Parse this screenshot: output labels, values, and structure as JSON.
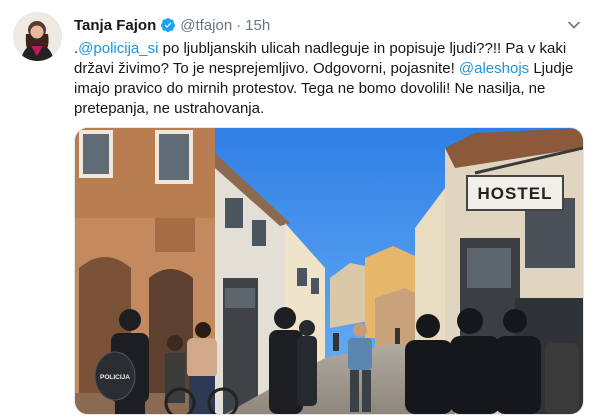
{
  "tweet": {
    "author_name": "Tanja Fajon",
    "handle": "@tfajon",
    "separator": "·",
    "time": "15h",
    "text_parts": {
      "p1": ".",
      "m1": "@policija_si",
      "p2": " po ljubljanskih ulicah nadleguje in popisuje ljudi??!! Pa v kaki državi živimo? To je nesprejemljivo. Odgovorni, pojasnite! ",
      "m2": "@aleshojs",
      "p3": " Ljudje imajo pravico do mirnih protestov. Tega ne bomo dovolili! Ne nasilja, ne pretepanja, ne ustrahovanja."
    }
  },
  "media": {
    "sign_text": "HOSTEL",
    "shield_text": "POLICIJA"
  },
  "colors": {
    "link": "#1b95e0",
    "verified": "#1da1f2",
    "muted": "#657786"
  },
  "icons": {
    "verified": "verified-badge-icon",
    "menu": "chevron-down-icon"
  }
}
